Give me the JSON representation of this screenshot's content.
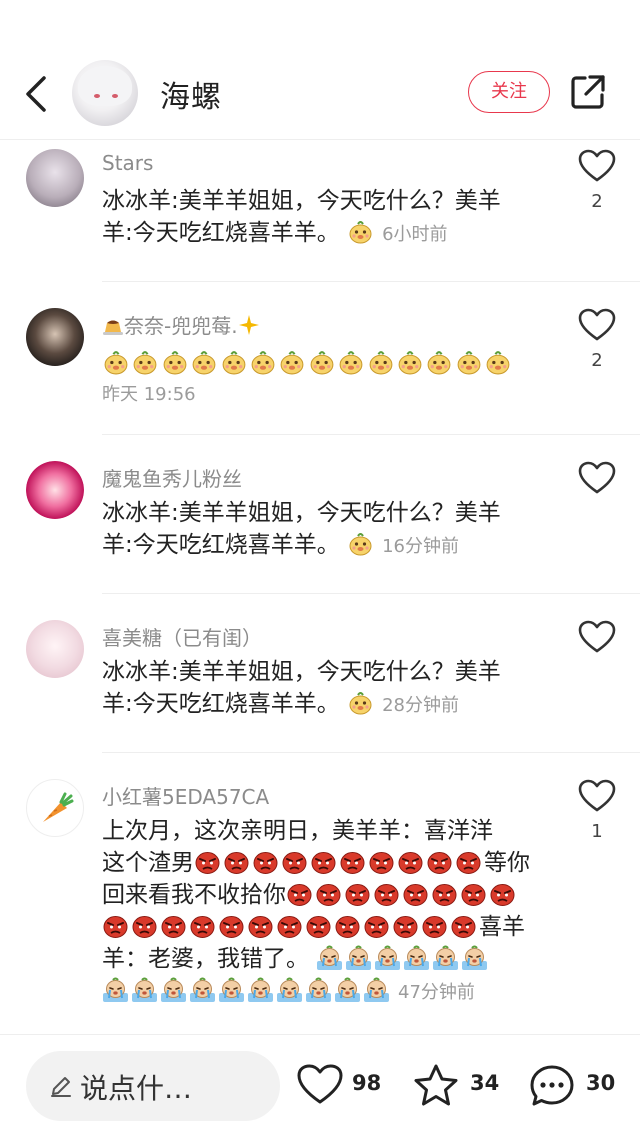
{
  "header": {
    "back_icon": "chevron-left-icon",
    "user_name": "海螺",
    "follow_label": "关注",
    "share_icon": "share-external-icon"
  },
  "comments": [
    {
      "name": "Stars",
      "text_line1": "冰冰羊:美羊羊姐姐，今天吃什么？美羊",
      "text_line2": "羊:今天吃红烧喜羊羊。",
      "time": "6小时前",
      "likes": "2"
    },
    {
      "name": "奈奈-兜兜莓.",
      "emoji_count": 14,
      "time": "昨天 19:56",
      "likes": "2"
    },
    {
      "name": "魔鬼鱼秀儿粉丝",
      "text_line1": "冰冰羊:美羊羊姐姐，今天吃什么？美羊",
      "text_line2": "羊:今天吃红烧喜羊羊。",
      "time": "16分钟前",
      "likes": ""
    },
    {
      "name": "喜美糖（已有闺）",
      "text_line1": "冰冰羊:美羊羊姐姐，今天吃什么？美羊",
      "text_line2": "羊:今天吃红烧喜羊羊。",
      "time": "28分钟前",
      "likes": ""
    },
    {
      "name": "小红薯5EDA57CA",
      "line1": "上次月，这次亲明日，美羊羊：喜洋洋",
      "line2_prefix": "这个渣男",
      "line2_suffix": "等你",
      "line3": "回来看我不收拾你",
      "line4_suffix": "喜羊",
      "line5": "羊：老婆，我错了。",
      "time": "47分钟前",
      "likes": "1"
    }
  ],
  "bottom_bar": {
    "input_placeholder": "说点什…",
    "likes_count": "98",
    "stars_count": "34",
    "comments_count": "30"
  },
  "colors": {
    "accent": "#e8384d",
    "muted_text": "#8b8b8b"
  }
}
